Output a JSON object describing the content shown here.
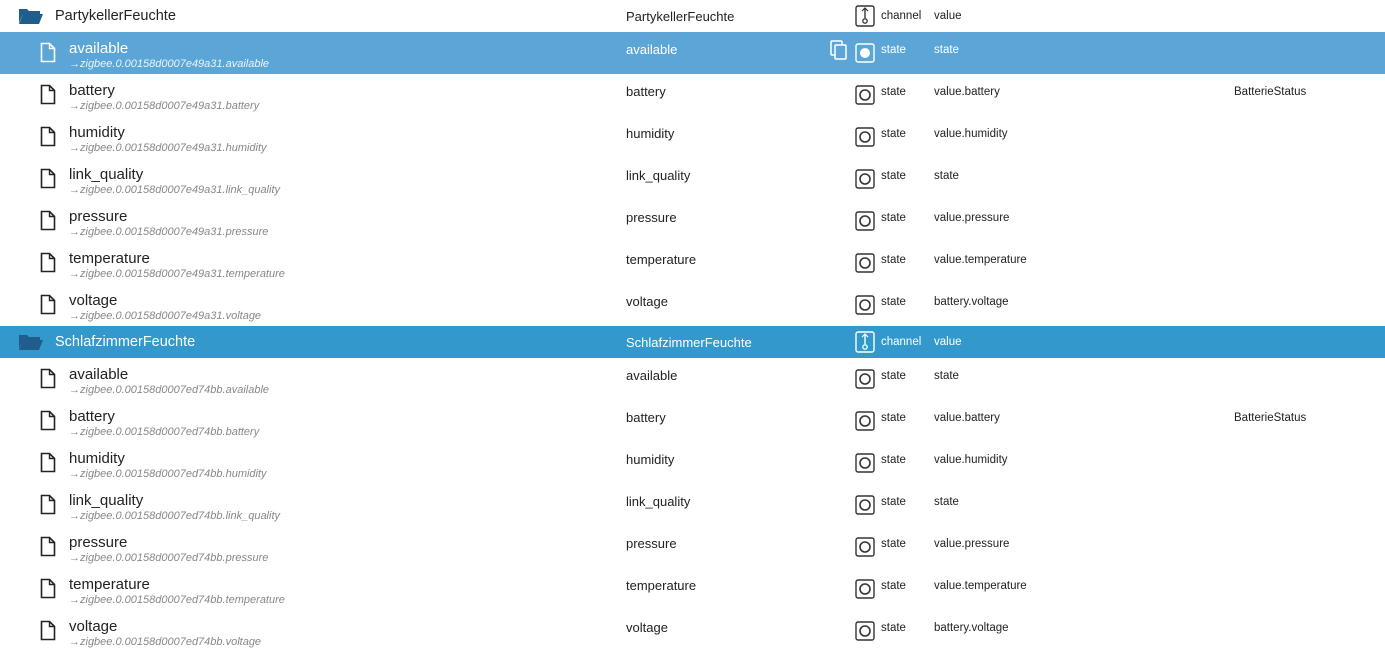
{
  "colors": {
    "selected_row": "#5ba6d6",
    "folder_highlight": "#3399cc",
    "folder_icon": "#1e5d8c"
  },
  "groups": [
    {
      "name": "PartykellerFeuchte",
      "display_name": "PartykellerFeuchte",
      "type": "channel",
      "role": "value",
      "highlighted": false,
      "states": [
        {
          "name": "available",
          "alias": "→zigbee.0.00158d0007e49a31.available",
          "display_name": "available",
          "type": "state",
          "role": "state",
          "function": "",
          "selected": true
        },
        {
          "name": "battery",
          "alias": "→zigbee.0.00158d0007e49a31.battery",
          "display_name": "battery",
          "type": "state",
          "role": "value.battery",
          "function": "BatterieStatus",
          "selected": false
        },
        {
          "name": "humidity",
          "alias": "→zigbee.0.00158d0007e49a31.humidity",
          "display_name": "humidity",
          "type": "state",
          "role": "value.humidity",
          "function": "",
          "selected": false
        },
        {
          "name": "link_quality",
          "alias": "→zigbee.0.00158d0007e49a31.link_quality",
          "display_name": "link_quality",
          "type": "state",
          "role": "state",
          "function": "",
          "selected": false
        },
        {
          "name": "pressure",
          "alias": "→zigbee.0.00158d0007e49a31.pressure",
          "display_name": "pressure",
          "type": "state",
          "role": "value.pressure",
          "function": "",
          "selected": false
        },
        {
          "name": "temperature",
          "alias": "→zigbee.0.00158d0007e49a31.temperature",
          "display_name": "temperature",
          "type": "state",
          "role": "value.temperature",
          "function": "",
          "selected": false
        },
        {
          "name": "voltage",
          "alias": "→zigbee.0.00158d0007e49a31.voltage",
          "display_name": "voltage",
          "type": "state",
          "role": "battery.voltage",
          "function": "",
          "selected": false
        }
      ]
    },
    {
      "name": "SchlafzimmerFeuchte",
      "display_name": "SchlafzimmerFeuchte",
      "type": "channel",
      "role": "value",
      "highlighted": true,
      "states": [
        {
          "name": "available",
          "alias": "→zigbee.0.00158d0007ed74bb.available",
          "display_name": "available",
          "type": "state",
          "role": "state",
          "function": "",
          "selected": false
        },
        {
          "name": "battery",
          "alias": "→zigbee.0.00158d0007ed74bb.battery",
          "display_name": "battery",
          "type": "state",
          "role": "value.battery",
          "function": "BatterieStatus",
          "selected": false
        },
        {
          "name": "humidity",
          "alias": "→zigbee.0.00158d0007ed74bb.humidity",
          "display_name": "humidity",
          "type": "state",
          "role": "value.humidity",
          "function": "",
          "selected": false
        },
        {
          "name": "link_quality",
          "alias": "→zigbee.0.00158d0007ed74bb.link_quality",
          "display_name": "link_quality",
          "type": "state",
          "role": "state",
          "function": "",
          "selected": false
        },
        {
          "name": "pressure",
          "alias": "→zigbee.0.00158d0007ed74bb.pressure",
          "display_name": "pressure",
          "type": "state",
          "role": "value.pressure",
          "function": "",
          "selected": false
        },
        {
          "name": "temperature",
          "alias": "→zigbee.0.00158d0007ed74bb.temperature",
          "display_name": "temperature",
          "type": "state",
          "role": "value.temperature",
          "function": "",
          "selected": false
        },
        {
          "name": "voltage",
          "alias": "→zigbee.0.00158d0007ed74bb.voltage",
          "display_name": "voltage",
          "type": "state",
          "role": "battery.voltage",
          "function": "",
          "selected": false
        }
      ]
    }
  ]
}
